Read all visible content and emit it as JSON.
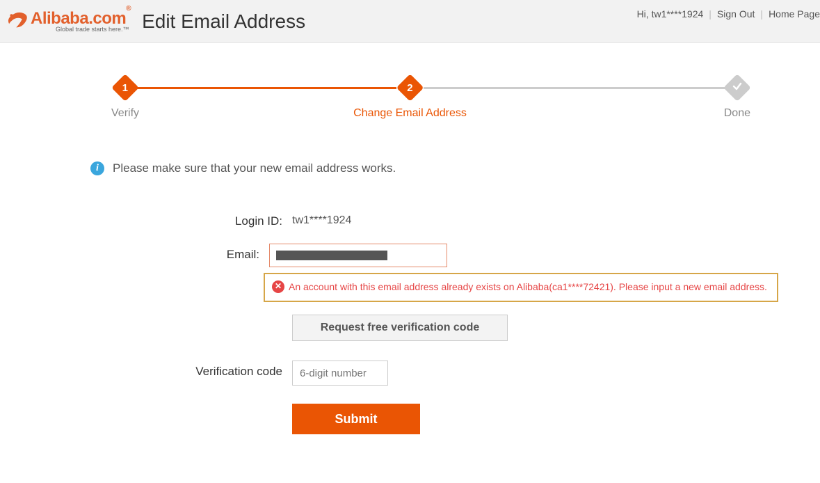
{
  "brand": {
    "name_main": "Alibaba",
    "name_suffix": ".com",
    "reg_mark": "®",
    "tagline": "Global trade starts here.™"
  },
  "page_title": "Edit Email Address",
  "header": {
    "greeting": "Hi, tw1****1924",
    "sign_out": "Sign Out",
    "home": "Home Page"
  },
  "steps": {
    "s1_num": "1",
    "s1_label": "Verify",
    "s2_num": "2",
    "s2_label": "Change Email Address",
    "s3_label": "Done"
  },
  "info_text": "Please make sure that your new email address works.",
  "form": {
    "login_id_label": "Login ID:",
    "login_id_value": "tw1****1924",
    "email_label": "Email:",
    "email_value": "",
    "error_text": "An account with this email address already exists on Alibaba(ca1****72421). Please input a new email address.",
    "request_code_label": "Request free verification code",
    "vcode_label": "Verification code",
    "vcode_placeholder": "6-digit number",
    "submit_label": "Submit"
  }
}
